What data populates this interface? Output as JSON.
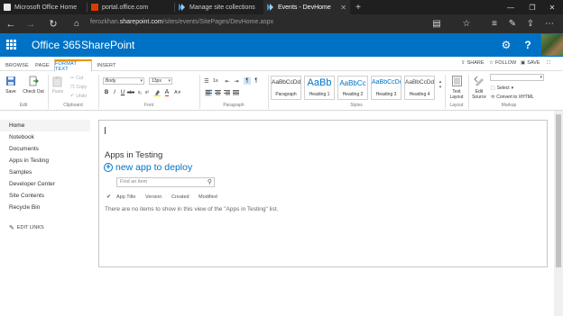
{
  "browser": {
    "tabs": [
      {
        "title": "Microsoft Office Home",
        "active": false
      },
      {
        "title": "portal.office.com",
        "active": false
      },
      {
        "title": "Manage site collections",
        "active": false
      },
      {
        "title": "Events - DevHome",
        "active": true
      }
    ],
    "url_prefix": "ferozkhan.",
    "url_host": "sharepoint.com",
    "url_path": "/sites/events/SitePages/DevHome.aspx"
  },
  "suite": {
    "brand": "Office 365",
    "app": "SharePoint"
  },
  "ribbon_tabs": [
    "BROWSE",
    "PAGE",
    "FORMAT TEXT",
    "INSERT"
  ],
  "ribbon_actions": {
    "share": "SHARE",
    "follow": "FOLLOW",
    "save": "SAVE"
  },
  "ribbon": {
    "save": "Save",
    "check_out": "Check Out",
    "paste": "Paste",
    "cut": "Cut",
    "copy": "Copy",
    "undo": "Undo",
    "font_name": "Body",
    "font_size": "13px",
    "styles": [
      {
        "sample": "AaBbCcDdI",
        "name": "Paragraph"
      },
      {
        "sample": "AaBb",
        "name": "Heading 1"
      },
      {
        "sample": "AaBbCc",
        "name": "Heading 2"
      },
      {
        "sample": "AaBbCcDc",
        "name": "Heading 3"
      },
      {
        "sample": "AaBbCcDd",
        "name": "Heading 4"
      }
    ],
    "text_layout": "Text Layout",
    "edit_source": "Edit Source",
    "select": "Select",
    "convert_xhtml": "Convert to XHTML",
    "groups": {
      "edit": "Edit",
      "clipboard": "Clipboard",
      "font": "Font",
      "paragraph": "Paragraph",
      "styles": "Styles",
      "layout": "Layout",
      "markup": "Markup"
    }
  },
  "leftnav": {
    "items": [
      "Home",
      "Notebook",
      "Documents",
      "Apps in Testing",
      "Samples",
      "Developer Center",
      "Site Contents",
      "Recycle Bin"
    ],
    "edit_links": "EDIT LINKS"
  },
  "content": {
    "part_title": "Apps in Testing",
    "new_app": "new app to deploy",
    "find_placeholder": "Find an item",
    "columns": [
      "App Title",
      "Version",
      "Created",
      "Modified"
    ],
    "empty_message": "There are no items to show in this view of the \"Apps in Testing\" list."
  },
  "colors": {
    "suite_blue": "#0072c6",
    "active_tab_accent": "#e69500"
  }
}
